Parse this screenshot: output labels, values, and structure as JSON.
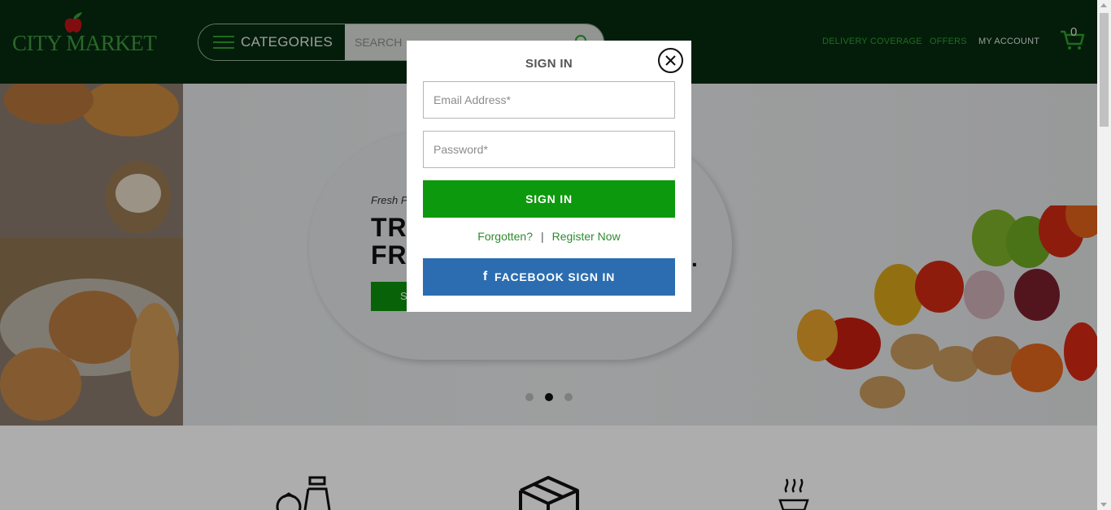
{
  "header": {
    "logo_text": "CITY MARKET",
    "categories_label": "CATEGORIES",
    "search_placeholder": "SEARCH",
    "nav": {
      "delivery": "DELIVERY COVERAGE",
      "offers": "OFFERS",
      "account": "MY ACCOUNT"
    },
    "cart_count": "0"
  },
  "hero": {
    "small_text": "Fresh P",
    "title_line1": "TRY",
    "title_line2": "FR",
    "title_end": ".",
    "button_label": "S",
    "slides": 3,
    "active_slide": 2
  },
  "modal": {
    "title": "SIGN IN",
    "email_placeholder": "Email Address*",
    "password_placeholder": "Password*",
    "signin_label": "SIGN IN",
    "forgotten_label": "Forgotten?",
    "separator": "|",
    "register_label": "Register Now",
    "facebook_label": "FACEBOOK SIGN IN"
  },
  "colors": {
    "header_bg": "#062b0f",
    "brand_green": "#0d990d",
    "link_green": "#2e8b2e",
    "facebook_blue": "#2b6db0"
  },
  "icons": {
    "close": "close-icon",
    "search": "search-icon",
    "cart": "cart-icon",
    "facebook": "facebook-icon",
    "menu": "hamburger-icon"
  }
}
